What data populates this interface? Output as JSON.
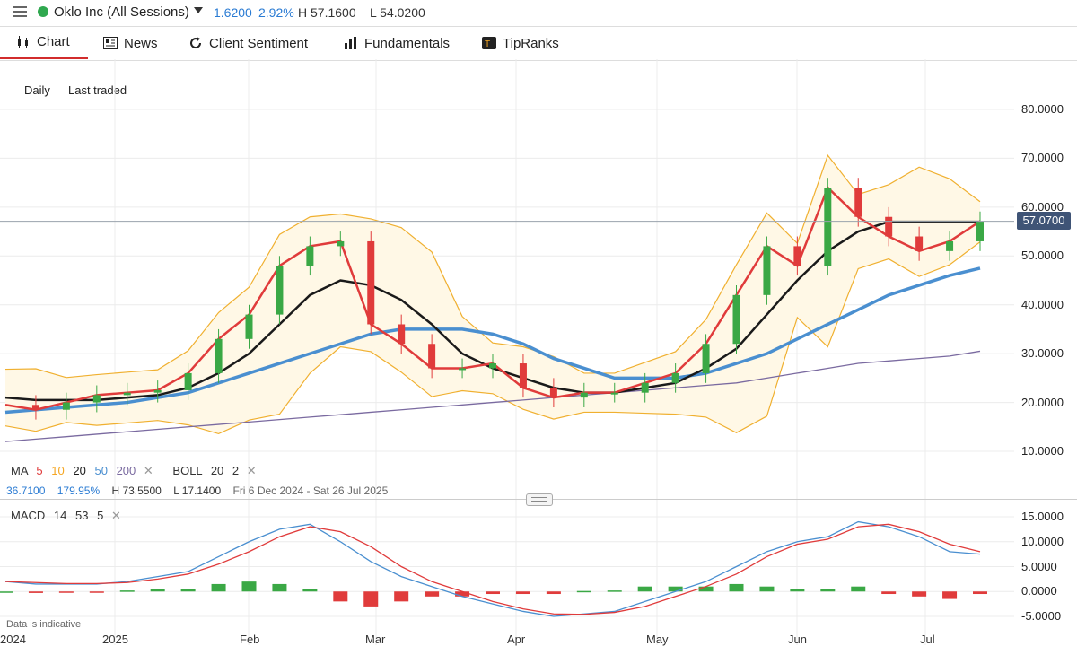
{
  "header": {
    "instrument": "Oklo Inc (All Sessions)",
    "change": "1.6200",
    "change_pct": "2.92%",
    "high": "H 57.1600",
    "low": "L 54.0200"
  },
  "tabs": [
    {
      "label": "Chart",
      "icon": "candlestick-icon",
      "active": true
    },
    {
      "label": "News",
      "icon": "newspaper-icon"
    },
    {
      "label": "Client Sentiment",
      "icon": "refresh-icon"
    },
    {
      "label": "Fundamentals",
      "icon": "bar-chart-icon"
    },
    {
      "label": "TipRanks",
      "icon": "tipranks-logo-icon"
    }
  ],
  "controls": {
    "interval": "Daily",
    "price_type": "Last traded"
  },
  "price_axis": {
    "ticks": [
      "80.0000",
      "70.0000",
      "60.0000",
      "50.0000",
      "40.0000",
      "30.0000",
      "20.0000",
      "10.0000"
    ],
    "last_price": "57.0700"
  },
  "x_axis": {
    "ticks": [
      "2024",
      "2025",
      "Feb",
      "Mar",
      "Apr",
      "May",
      "Jun",
      "Jul"
    ]
  },
  "ma_legend": {
    "label": "MA",
    "p1": "5",
    "p2": "10",
    "p3": "20",
    "p4": "50",
    "p5": "200",
    "boll_label": "BOLL",
    "boll_p1": "20",
    "boll_p2": "2"
  },
  "stats": {
    "value": "36.7100",
    "pct": "179.95%",
    "high": "H 73.5500",
    "low": "L 17.1400",
    "range": "Fri 6 Dec 2024 - Sat 26 Jul 2025"
  },
  "macd_legend": {
    "label": "MACD",
    "p1": "14",
    "p2": "53",
    "p3": "5"
  },
  "macd_axis": {
    "ticks": [
      "15.0000",
      "10.0000",
      "5.0000",
      "0.0000",
      "-5.0000"
    ]
  },
  "footer_note": "Data is indicative",
  "colors": {
    "up": "#3aa845",
    "down": "#e03b3b",
    "ma5": "#e03b3b",
    "ma10": "#f5a623",
    "ma20": "#1a1a1a",
    "ma50": "#4a8fd0",
    "ma200": "#7a6aa0",
    "boll": "#f0b030"
  },
  "chart_data": {
    "type": "line",
    "x": [
      "2024-12-09",
      "2024-12-16",
      "2024-12-23",
      "2024-12-30",
      "2025-01-06",
      "2025-01-13",
      "2025-01-21",
      "2025-01-27",
      "2025-02-03",
      "2025-02-10",
      "2025-02-18",
      "2025-02-24",
      "2025-03-03",
      "2025-03-10",
      "2025-03-17",
      "2025-03-24",
      "2025-03-31",
      "2025-04-07",
      "2025-04-14",
      "2025-04-21",
      "2025-04-28",
      "2025-05-05",
      "2025-05-12",
      "2025-05-19",
      "2025-05-27",
      "2025-06-02",
      "2025-06-09",
      "2025-06-16",
      "2025-06-23",
      "2025-06-30",
      "2025-07-07",
      "2025-07-14",
      "2025-07-21"
    ],
    "series": [
      {
        "values": [
          19.5,
          18.5,
          20,
          21.5,
          22,
          22.5,
          26,
          33,
          38,
          48,
          52,
          53,
          36,
          32,
          27,
          27,
          28,
          23,
          21,
          22,
          22,
          24,
          26,
          32,
          42,
          52,
          48,
          64,
          58,
          54,
          51,
          53,
          57.1
        ]
      },
      {
        "values": [
          21,
          20.5,
          20.5,
          20.5,
          21,
          21.5,
          23,
          26,
          30,
          36,
          42,
          45,
          44,
          41,
          36,
          30,
          27,
          25,
          23,
          22,
          22,
          23,
          24,
          27,
          31,
          38,
          45,
          51,
          55,
          57,
          57,
          57,
          57
        ]
      },
      {
        "values": [
          18,
          18.5,
          19,
          19.5,
          20,
          21,
          22,
          24,
          26,
          28,
          30,
          32,
          34,
          35,
          35,
          35,
          34,
          32,
          29,
          27,
          25,
          25,
          25,
          26,
          28,
          30,
          33,
          36,
          39,
          42,
          44,
          46,
          47.5
        ]
      },
      {
        "values": [
          12,
          12.5,
          13,
          13.5,
          14,
          14.5,
          15,
          15.5,
          16,
          16.5,
          17,
          17.5,
          18,
          18.5,
          19,
          19.5,
          20,
          20.5,
          21,
          21.5,
          22,
          22.5,
          23,
          23.5,
          24,
          25,
          26,
          27,
          28,
          28.5,
          29,
          29.5,
          30.5
        ]
      }
    ],
    "macd": {
      "macd": [
        2,
        1.5,
        1.5,
        1.5,
        2,
        3,
        4,
        7,
        10,
        12.5,
        13.5,
        10,
        6,
        3,
        1,
        -1,
        -2.5,
        -4,
        -5,
        -4.5,
        -4,
        -2,
        0,
        2,
        5,
        8,
        10,
        11,
        14,
        13,
        11,
        8,
        7.5
      ],
      "signal": [
        2,
        1.8,
        1.6,
        1.6,
        1.8,
        2.5,
        3.5,
        5.5,
        8,
        11,
        13,
        12,
        9,
        5,
        2,
        0,
        -2,
        -3.5,
        -4.5,
        -4.6,
        -4.2,
        -3,
        -1,
        1,
        3.5,
        7,
        9.5,
        10.5,
        13,
        13.5,
        12,
        9.5,
        8
      ]
    },
    "ylim": [
      5,
      85
    ],
    "macd_ylim": [
      -7,
      16
    ]
  }
}
